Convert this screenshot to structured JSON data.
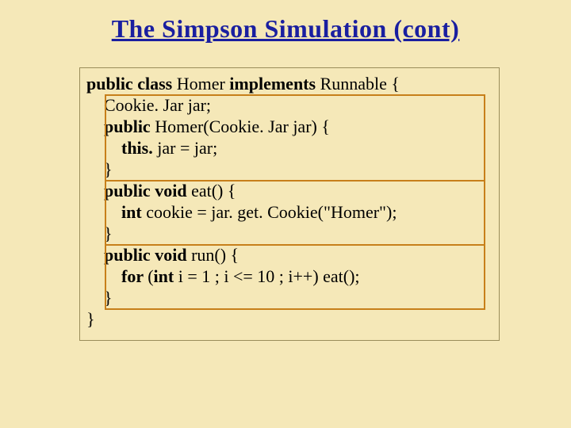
{
  "title": "The Simpson Simulation (cont)",
  "code": {
    "l0_a": "public class ",
    "l0_b": "Homer ",
    "l0_c": "implements ",
    "l0_d": "Runnable {",
    "l1": "    Cookie. Jar jar;",
    "l2_a": "    public ",
    "l2_b": "Homer(Cookie. Jar jar) {",
    "l3_a": "        this. ",
    "l3_b": "jar = jar;",
    "l4": "    }",
    "l5_a": "    public ",
    "l5_b": "void ",
    "l5_c": "eat() {",
    "l6_a": "        int ",
    "l6_b": "cookie = jar. get. Cookie(\"Homer\");",
    "l7": "    }",
    "l8_a": "    public ",
    "l8_b": "void ",
    "l8_c": "run() {",
    "l9_a": "        for ",
    "l9_b": "(",
    "l9_c": "int ",
    "l9_d": "i = 1 ; i <= 10 ; i++) eat();",
    "l10": "    }",
    "l11": "}"
  }
}
